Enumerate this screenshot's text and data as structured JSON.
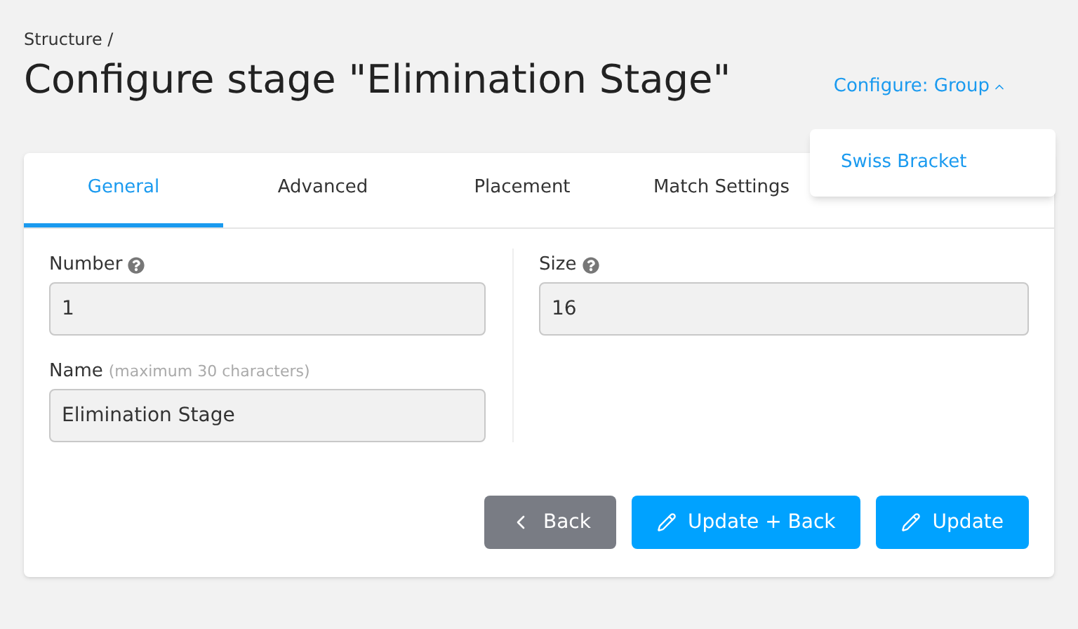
{
  "breadcrumb": "Structure /",
  "title": "Configure stage \"Elimination Stage\"",
  "configure_menu": {
    "label": "Configure: Group",
    "expanded": true,
    "items": [
      "Swiss Bracket"
    ]
  },
  "tabs": [
    {
      "label": "General",
      "selected": true
    },
    {
      "label": "Advanced",
      "selected": false
    },
    {
      "label": "Placement",
      "selected": false
    },
    {
      "label": "Match Settings",
      "selected": false
    }
  ],
  "left_fields": [
    {
      "label": "Number",
      "help": true,
      "value": "1"
    },
    {
      "label": "Name",
      "hint": "(maximum 30 characters)",
      "help": false,
      "value": "Elimination Stage"
    }
  ],
  "right_fields": [
    {
      "label": "Size",
      "help": true,
      "value": "16"
    }
  ],
  "buttons": [
    {
      "label": "Back",
      "kind": "back"
    },
    {
      "label": "Update + Back",
      "kind": "update"
    },
    {
      "label": "Update",
      "kind": "update"
    }
  ]
}
